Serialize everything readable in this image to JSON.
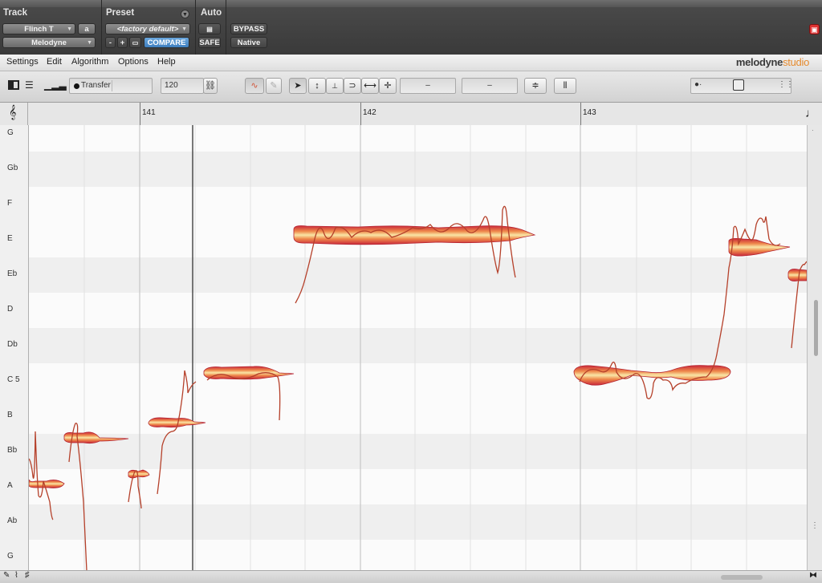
{
  "plugin_header": {
    "track_label": "Track",
    "preset_label": "Preset",
    "auto_label": "Auto",
    "track_name": "Flinch T",
    "track_channel": "a",
    "plugin_name": "Melodyne",
    "preset_value": "<factory default>",
    "minus": "-",
    "plus": "+",
    "compare": "COMPARE",
    "safe": "SAFE",
    "bypass": "BYPASS",
    "native": "Native"
  },
  "menu": {
    "items": [
      "Settings",
      "Edit",
      "Algorithm",
      "Options",
      "Help"
    ],
    "brand_main": "melodyne",
    "brand_sub": "studio"
  },
  "toolbar": {
    "transfer_label": "Transfer",
    "tempo": "120",
    "field_a": "–",
    "field_b": "–"
  },
  "ruler": {
    "bars": [
      "141",
      "142",
      "143"
    ]
  },
  "pitch_keys": [
    "G",
    "Gb",
    "F",
    "E",
    "Eb",
    "D",
    "Db",
    "C 5",
    "B",
    "Bb",
    "A",
    "Ab",
    "G"
  ],
  "colors": {
    "blob_outer": "#c9283a",
    "blob_inner": "#f6d98b",
    "pitch_curve": "#b5402a",
    "row_dark": "#eeeeee",
    "row_light": "#fbfbfb"
  }
}
